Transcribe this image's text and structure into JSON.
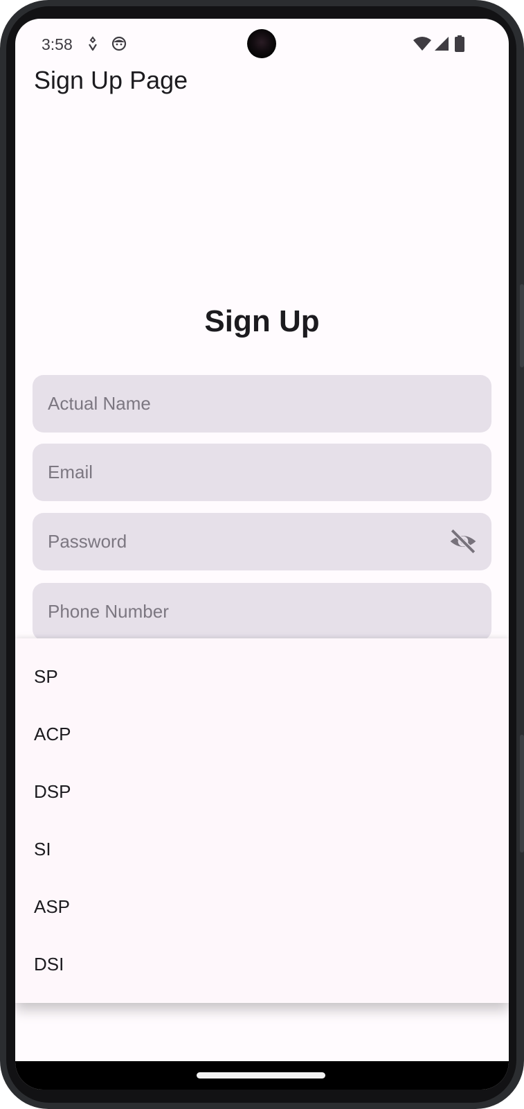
{
  "status_bar": {
    "time": "3:58",
    "left_icons": [
      "notification-icon",
      "face-icon"
    ],
    "right_icons": [
      "wifi-icon",
      "signal-icon",
      "battery-icon"
    ]
  },
  "app_bar": {
    "title": "Sign Up Page"
  },
  "form": {
    "heading": "Sign Up",
    "fields": [
      {
        "name": "actual-name",
        "placeholder": "Actual Name",
        "value": ""
      },
      {
        "name": "email",
        "placeholder": "Email",
        "value": ""
      },
      {
        "name": "password",
        "placeholder": "Password",
        "value": "",
        "trailing_icon": "visibility-off-icon"
      },
      {
        "name": "phone-number",
        "placeholder": "Phone Number",
        "value": ""
      }
    ]
  },
  "dropdown": {
    "options": [
      "SP",
      "ACP",
      "DSP",
      "SI",
      "ASP",
      "DSI"
    ]
  },
  "colors": {
    "background": "#fffbfe",
    "field_fill": "#e6e0e9",
    "placeholder": "#7c7781",
    "text": "#1c1b1f",
    "menu_surface": "#fef7fb"
  }
}
